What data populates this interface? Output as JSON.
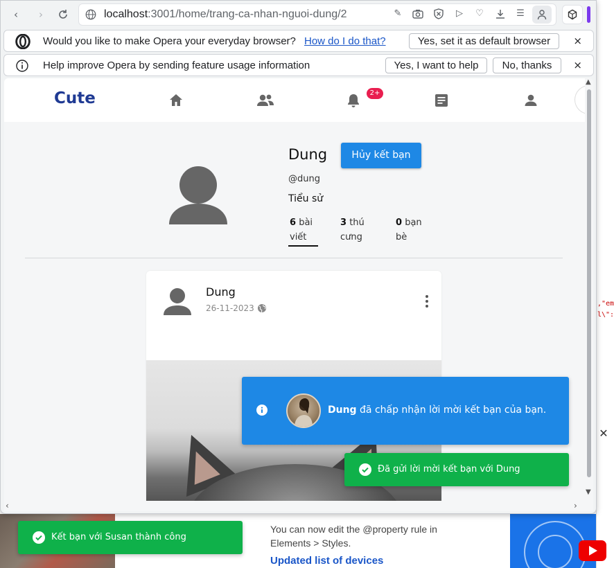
{
  "browser": {
    "url_host": "localhost",
    "url_path": ":3001/home/trang-ca-nhan-nguoi-dung/2",
    "infobar_default": {
      "message": "Would you like to make Opera your everyday browser?",
      "link": "How do I do that?",
      "button": "Yes, set it as default browser",
      "close": "×"
    },
    "infobar_usage": {
      "message": "Help improve Opera by sending feature usage information",
      "accept": "Yes, I want to help",
      "decline": "No, thanks",
      "close": "×"
    }
  },
  "app": {
    "logo": "Cute",
    "nav_icons": [
      "home-icon",
      "friends-icon",
      "bell-icon",
      "newsfeed-icon",
      "user-icon"
    ],
    "notification_badge": "2+"
  },
  "profile": {
    "name": "Dung",
    "unfriend_button": "Hủy kết bạn",
    "handle": "@dung",
    "bio_label": "Tiểu sử",
    "stats": [
      {
        "count": "6",
        "label_line1": "bài",
        "label_line2": "viết"
      },
      {
        "count": "3",
        "label_line1": "thú",
        "label_line2": "cưng"
      },
      {
        "count": "0",
        "label_line1": "bạn",
        "label_line2": "bè"
      }
    ]
  },
  "post": {
    "author": "Dung",
    "date": "26-11-2023"
  },
  "toasts": {
    "info_name": "Dung",
    "info_message": " đã chấp nhận lời mời kết bạn của bạn.",
    "success_sent": "Đã gửi lời mời kết bạn với Dung",
    "success_friend": "Kết bạn với Susan thành công"
  },
  "background": {
    "code_line1": ",\"ema",
    "code_line2": "l\\\":t",
    "article_text_line1": "You can now edit the @property rule in",
    "article_text_line2": "Elements > Styles.",
    "article_heading": "Updated list of devices"
  },
  "colors": {
    "primary": "#1e88e5",
    "success": "#0fb14a",
    "logo": "#1f3a93",
    "badge": "#e91e4f",
    "opera_accent": "#7c3aed"
  }
}
